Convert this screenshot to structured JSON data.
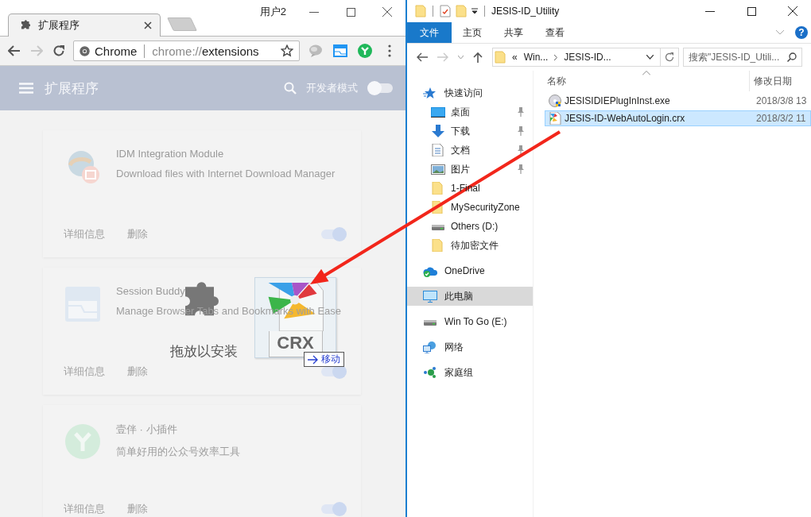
{
  "chrome": {
    "tab": {
      "title": "扩展程序"
    },
    "profile": "用户2",
    "omnibox": {
      "chip": "Chrome",
      "url": "chrome://extensions",
      "bookmarked": false
    },
    "page_header": {
      "title": "扩展程序",
      "developer_mode_label": "开发者模式",
      "developer_mode": false
    },
    "extensions": [
      {
        "kind": "idm",
        "name": "IDM Integration Module",
        "description": "Download files with Internet Download Manager",
        "details_link": "详细信息",
        "remove_link": "删除",
        "enabled": true
      },
      {
        "kind": "session",
        "name": "Session Buddy",
        "description": "Manage Browser Tabs and Bookmarks with Ease",
        "details_link": "详细信息",
        "remove_link": "删除",
        "enabled": true
      },
      {
        "kind": "y",
        "name": "壹伴 · 小插件",
        "description": "简单好用的公众号效率工具",
        "details_link": "详细信息",
        "remove_link": "删除",
        "enabled": true
      }
    ],
    "drop_hint": "拖放以安装",
    "drag_image": {
      "label": "CRX"
    },
    "drop_effect": "移动"
  },
  "explorer": {
    "title": "JESIS-ID_Utility",
    "ribbon_tabs": [
      {
        "label": "文件",
        "selected": true
      },
      {
        "label": "主页",
        "selected": false
      },
      {
        "label": "共享",
        "selected": false
      },
      {
        "label": "查看",
        "selected": false
      }
    ],
    "help": "?",
    "address": {
      "overflow": "«",
      "segments": [
        "Win...",
        "JESIS-ID..."
      ]
    },
    "search": {
      "placeholder": "搜索\"JESIS-ID_Utili..."
    },
    "nav": [
      {
        "label": "快速访问",
        "kind": "star",
        "selected": false,
        "children": [
          {
            "label": "桌面",
            "kind": "desktop",
            "pinned": true,
            "selected": false
          },
          {
            "label": "下载",
            "kind": "download",
            "pinned": true,
            "selected": false
          },
          {
            "label": "文档",
            "kind": "document",
            "pinned": true,
            "selected": false
          },
          {
            "label": "图片",
            "kind": "pictures",
            "pinned": true,
            "selected": false
          },
          {
            "label": "1-Final",
            "kind": "folder",
            "pinned": false,
            "selected": false
          },
          {
            "label": "MySecurityZone",
            "kind": "folder",
            "pinned": false,
            "selected": false
          },
          {
            "label": "Others (D:)",
            "kind": "drive",
            "pinned": false,
            "selected": false
          },
          {
            "label": "待加密文件",
            "kind": "folder",
            "pinned": false,
            "selected": false
          }
        ]
      },
      {
        "label": "OneDrive",
        "kind": "cloud",
        "selected": false
      },
      {
        "label": "此电脑",
        "kind": "pc",
        "selected": true
      },
      {
        "label": "Win To Go (E:)",
        "kind": "drive",
        "selected": false
      },
      {
        "label": "网络",
        "kind": "network",
        "selected": false
      },
      {
        "label": "家庭组",
        "kind": "homegroup",
        "selected": false
      }
    ],
    "columns": [
      "名称",
      "修改日期"
    ],
    "files": [
      {
        "name": "JESISIDIEPlugInInst.exe",
        "kind": "installer",
        "modified": "2018/3/8 13",
        "selected": false
      },
      {
        "name": "JESIS-ID-WebAutoLogin.crx",
        "kind": "crx",
        "modified": "2018/3/2 11",
        "selected": true
      }
    ]
  }
}
